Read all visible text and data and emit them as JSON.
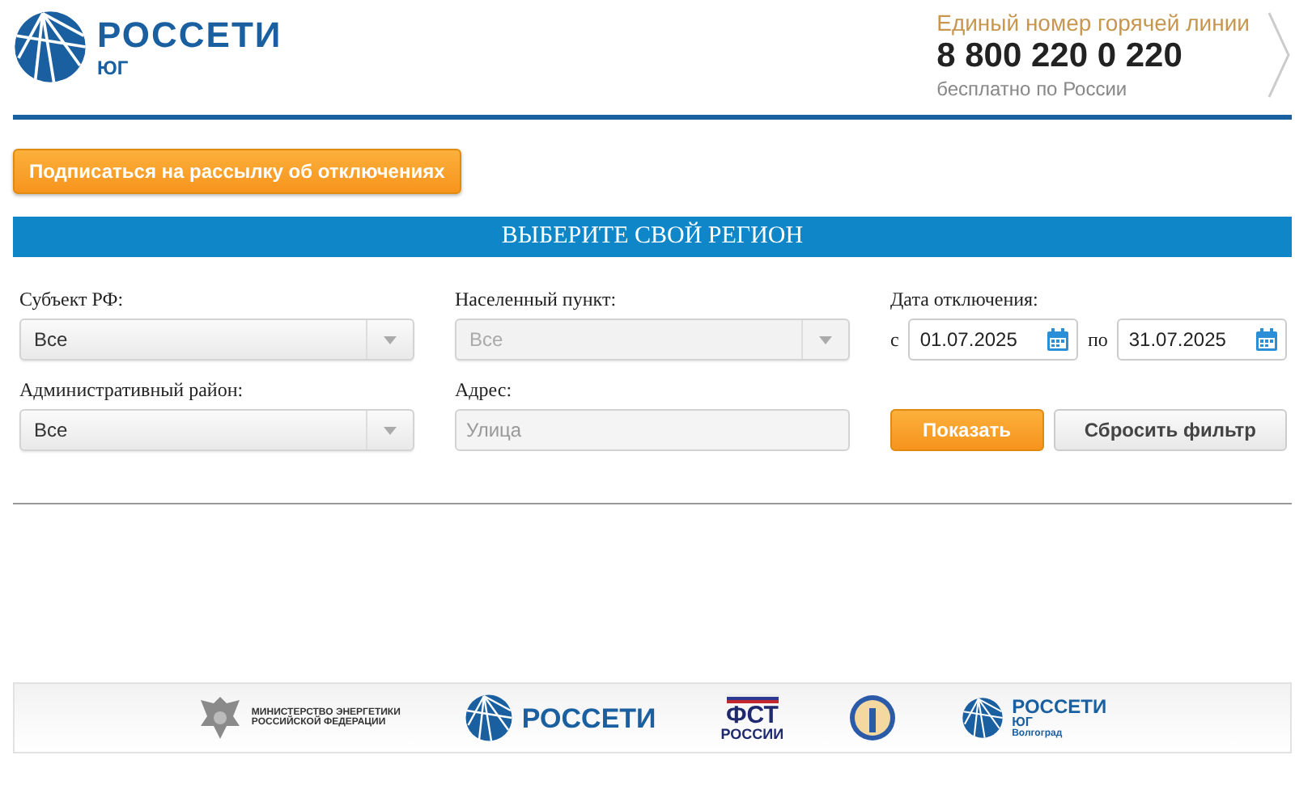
{
  "header": {
    "logo": {
      "name": "РОССЕТИ",
      "region": "ЮГ"
    },
    "hotline": {
      "title": "Единый номер горячей линии",
      "phone": "8 800 220 0 220",
      "note": "бесплатно по России"
    }
  },
  "subscribe_button": "Подписаться на рассылку об отключениях",
  "region_bar": "ВЫБЕРИТЕ СВОЙ РЕГИОН",
  "filters": [
    {
      "kind": "select",
      "label": "Субъект РФ:",
      "value": "Все",
      "disabled": false
    },
    {
      "kind": "select",
      "label": "Населенный пункт:",
      "value": "Все",
      "disabled": true
    },
    {
      "kind": "dates",
      "label": "Дата отключения:",
      "from_label": "с",
      "from": "01.07.2025",
      "to_label": "по",
      "to": "31.07.2025"
    },
    {
      "kind": "select",
      "label": "Административный район:",
      "value": "Все",
      "disabled": false
    },
    {
      "kind": "text",
      "label": "Адрес:",
      "placeholder": "Улица"
    },
    {
      "kind": "buttons",
      "primary": "Показать",
      "secondary": "Сбросить фильтр"
    }
  ],
  "footer_logos": [
    {
      "kind": "ministry",
      "lines": [
        "МИНИСТЕРСТВО ЭНЕРГЕТИКИ",
        "РОССИЙСКОЙ ФЕДЕРАЦИИ"
      ]
    },
    {
      "kind": "rosseti",
      "lines": [
        "РОССЕТИ"
      ]
    },
    {
      "kind": "fst",
      "lines": [
        "ФСТ",
        "РОССИИ"
      ]
    },
    {
      "kind": "emblem"
    },
    {
      "kind": "rosseti_south",
      "lines": [
        "РОССЕТИ",
        "ЮГ",
        "Волгоград"
      ]
    }
  ]
}
